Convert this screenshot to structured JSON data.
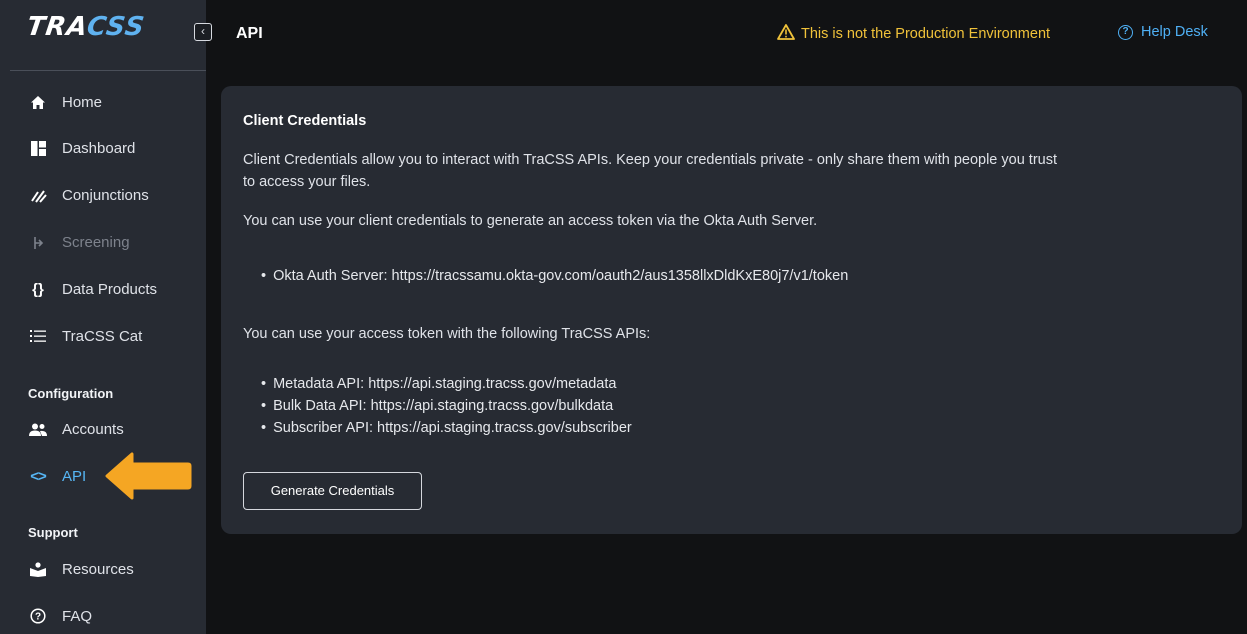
{
  "app": {
    "logo_trac": "TRA",
    "logo_css": "CSS"
  },
  "header": {
    "title": "API",
    "env_warning": "This is not the Production Environment",
    "help_desk": "Help Desk"
  },
  "sidebar": {
    "items": [
      {
        "label": "Home",
        "icon": "home-icon"
      },
      {
        "label": "Dashboard",
        "icon": "dashboard-icon"
      },
      {
        "label": "Conjunctions",
        "icon": "conjunctions-icon"
      },
      {
        "label": "Screening",
        "icon": "screening-icon",
        "disabled": true
      },
      {
        "label": "Data Products",
        "icon": "braces-icon"
      },
      {
        "label": "TraCSS Cat",
        "icon": "list-icon"
      }
    ],
    "configuration_label": "Configuration",
    "configuration_items": [
      {
        "label": "Accounts",
        "icon": "accounts-icon"
      },
      {
        "label": "API",
        "icon": "code-icon",
        "active": true
      }
    ],
    "support_label": "Support",
    "support_items": [
      {
        "label": "Resources",
        "icon": "resources-icon"
      },
      {
        "label": "FAQ",
        "icon": "help-circle-icon"
      }
    ]
  },
  "card": {
    "title": "Client Credentials",
    "intro_line1": "Client Credentials allow you to interact with TraCSS APIs. Keep your credentials private - only share them with people you trust",
    "intro_line2": "to access your files.",
    "okta_intro": "You can use your client credentials to generate an access token via the Okta Auth Server.",
    "okta_server": "Okta Auth Server: https://tracssamu.okta-gov.com/oauth2/aus1358llxDldKxE80j7/v1/token",
    "apis_intro": "You can use your access token with the following TraCSS APIs:",
    "apis": [
      "Metadata API: https://api.staging.tracss.gov/metadata",
      "Bulk Data API: https://api.staging.tracss.gov/bulkdata",
      "Subscriber API: https://api.staging.tracss.gov/subscriber"
    ],
    "button_label": "Generate Credentials"
  },
  "colors": {
    "accent": "#56b6f5",
    "warning": "#f0c23a",
    "annotation_arrow": "#f5a623"
  }
}
